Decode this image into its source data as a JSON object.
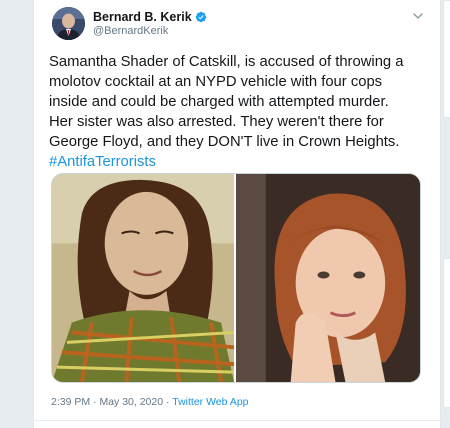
{
  "tweet": {
    "author_name": "Bernard B. Kerik",
    "author_handle": "@BernardKerik",
    "text": "Samantha Shader of Catskill, is accused of throwing a\nmolotov cocktail at an NYPD vehicle with four cops\ninside and could be charged with attempted murder.\nHer sister was also arrested. They weren't there for\nGeorge Floyd, and they DON'T live in Crown Heights.\n",
    "hashtag": "#AntifaTerrorists",
    "time": "2:39 PM",
    "separator": "·",
    "date": "May 30, 2020",
    "source": "Twitter Web App"
  },
  "icons": {
    "verified": "verified-badge-icon",
    "menu": "chevron-down-icon"
  },
  "colors": {
    "link": "#1b95e0",
    "verified": "#1da1f2",
    "text": "#14171a",
    "muted": "#657786",
    "background": "#e6ecf0"
  }
}
